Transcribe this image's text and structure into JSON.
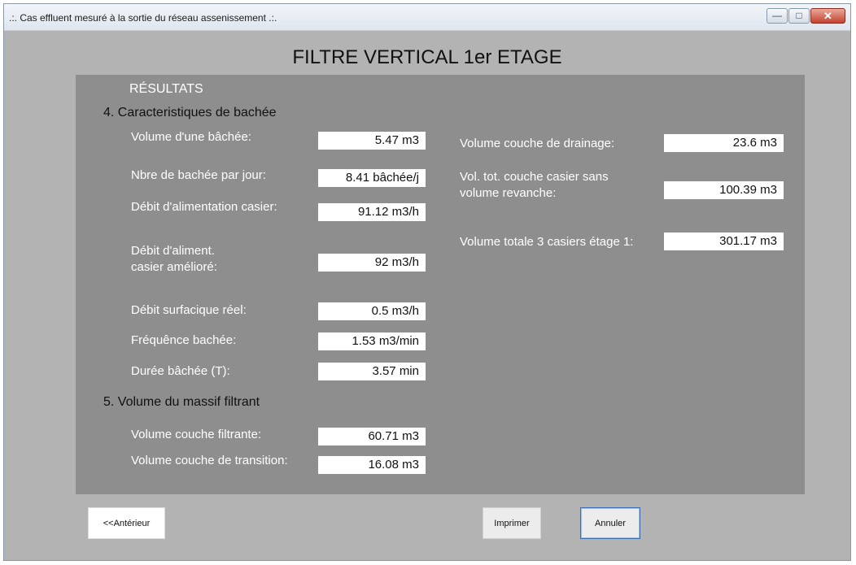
{
  "window": {
    "title": ".:. Cas effluent mesuré à la sortie du réseau assenissement .:.",
    "controls": {
      "minimize_icon": "minimize-icon",
      "maximize_icon": "maximize-icon",
      "close_icon": "close-icon"
    }
  },
  "heading": "FILTRE VERTICAL 1er ETAGE",
  "panel": {
    "results_title": "RÉSULTATS",
    "section4_title": "4. Caracteristiques de bachée",
    "section5_title": "5. Volume du massif filtrant",
    "left_fields": [
      {
        "label": "Volume d'une bâchée:",
        "value": "5.47 m3"
      },
      {
        "label": "Nbre de bachée par jour:",
        "value": "8.41 bâchée/j"
      },
      {
        "label": "Débit d'alimentation casier:",
        "value": "91.12 m3/h"
      },
      {
        "label_line1": "Débit d'aliment.",
        "label_line2": "casier amélioré:",
        "value": "92 m3/h"
      },
      {
        "label": "Débit surfacique réel:",
        "value": "0.5 m3/h"
      },
      {
        "label": "Fréquênce bachée:",
        "value": "1.53 m3/min"
      },
      {
        "label": "Durée bâchée (T):",
        "value": "3.57 min"
      }
    ],
    "section5_fields": [
      {
        "label": "Volume couche filtrante:",
        "value": "60.71 m3"
      },
      {
        "label": "Volume couche de transition:",
        "value": "16.08 m3"
      }
    ],
    "right_fields": [
      {
        "label": "Volume couche de drainage:",
        "value": "23.6 m3"
      },
      {
        "label_line1": "Vol. tot. couche casier sans",
        "label_line2": "volume revanche:",
        "value": "100.39 m3"
      },
      {
        "label": "Volume totale 3 casiers étage 1:",
        "value": "301.17 m3"
      }
    ]
  },
  "buttons": {
    "previous": "<<Antérieur",
    "print": "Imprimer",
    "cancel": "Annuler"
  },
  "colors": {
    "window_bg": "#b3b3b3",
    "panel_bg": "#8e8e8e",
    "field_bg": "#ffffff",
    "close_button": "#c5432f"
  }
}
